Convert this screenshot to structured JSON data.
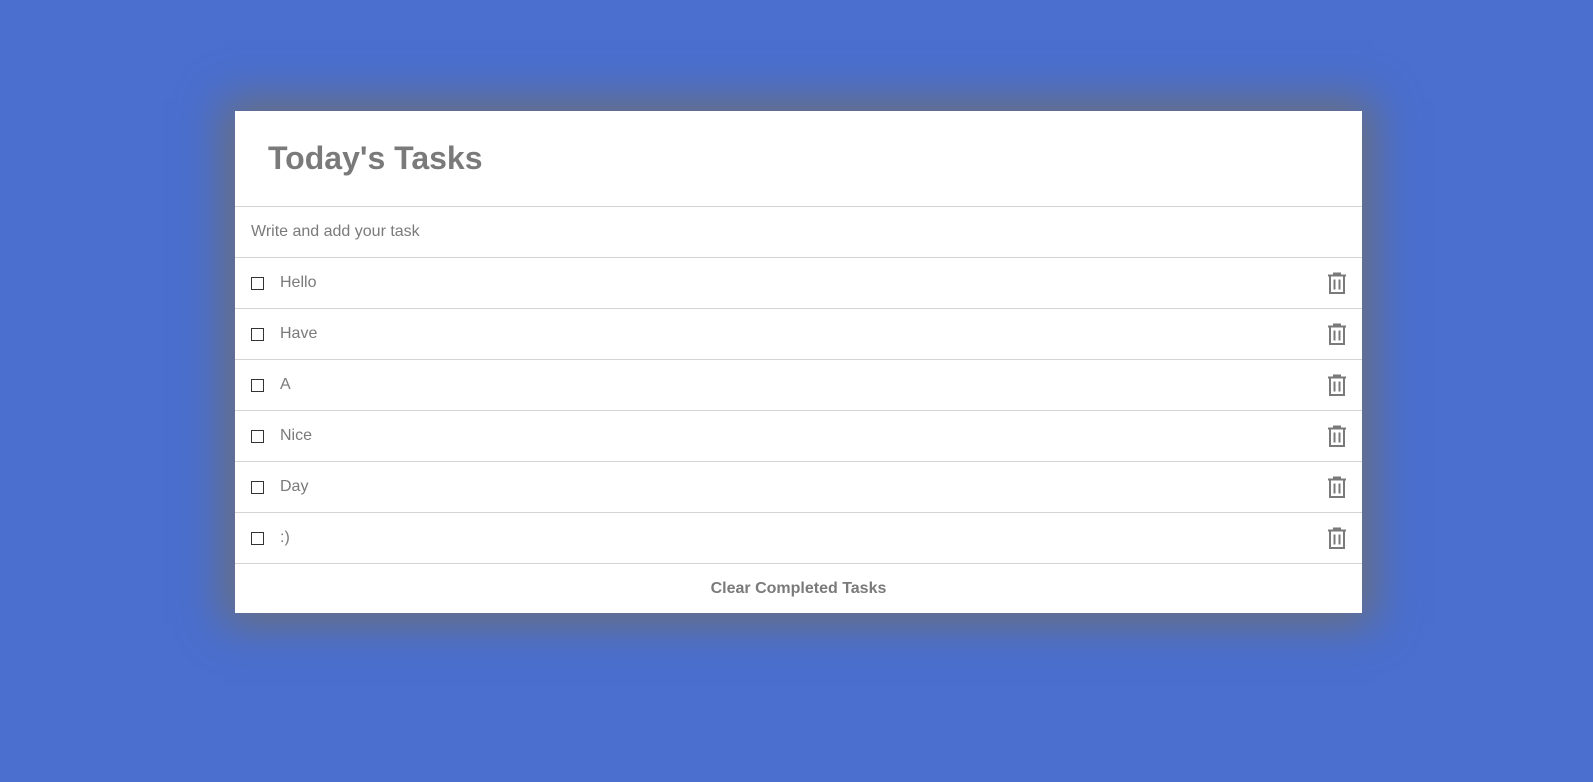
{
  "header": {
    "title": "Today's Tasks"
  },
  "input": {
    "placeholder": "Write and add your task",
    "value": ""
  },
  "tasks": [
    {
      "text": "Hello",
      "completed": false
    },
    {
      "text": "Have",
      "completed": false
    },
    {
      "text": "A",
      "completed": false
    },
    {
      "text": "Nice",
      "completed": false
    },
    {
      "text": "Day",
      "completed": false
    },
    {
      "text": ":)",
      "completed": false
    }
  ],
  "footer": {
    "clear_label": "Clear Completed Tasks"
  },
  "icons": {
    "delete": "trash-icon"
  },
  "colors": {
    "background": "#4a6fcf",
    "card": "#ffffff",
    "text": "#7a7a7a",
    "divider": "#d4d4d4"
  }
}
